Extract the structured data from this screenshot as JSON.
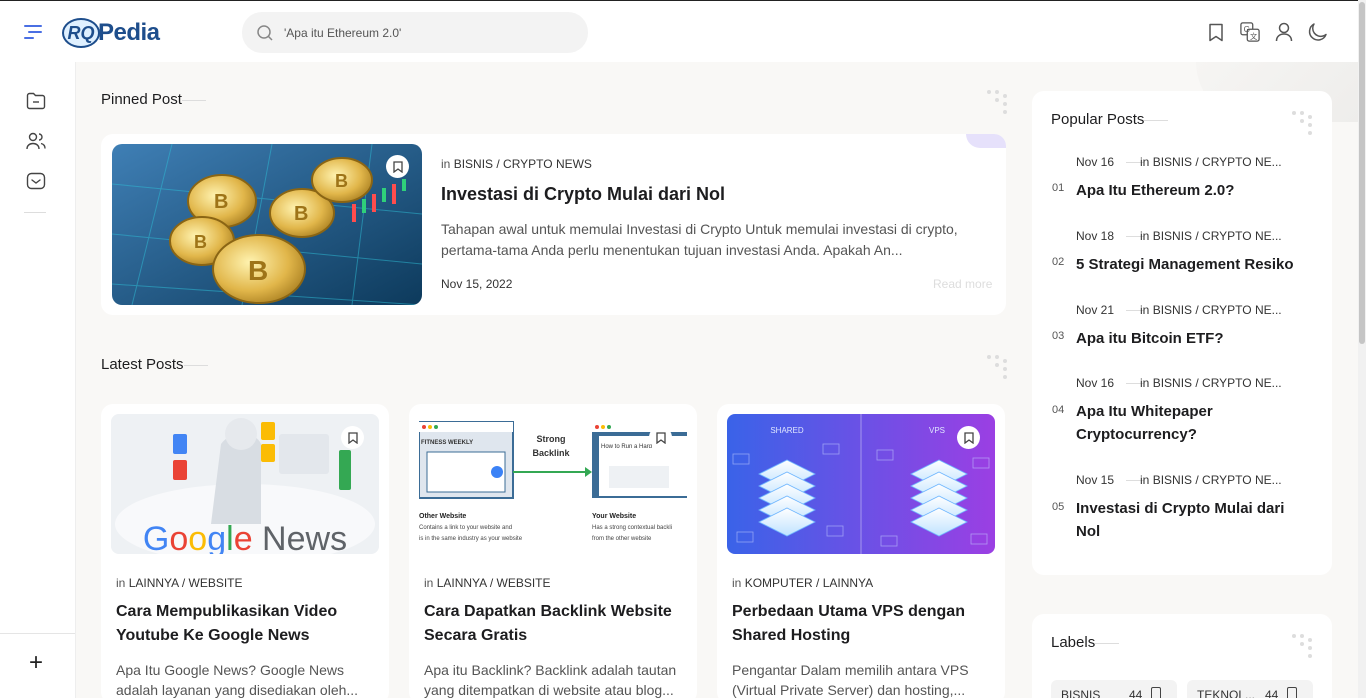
{
  "header": {
    "logo_rq": "RQ",
    "logo_pedia": "Pedia",
    "search_placeholder": "'Apa itu Ethereum 2.0'"
  },
  "pinned": {
    "section_title": "Pinned Post",
    "in_label": "in",
    "category": "BISNIS / CRYPTO NEWS",
    "title": "Investasi di Crypto Mulai dari Nol",
    "excerpt": "Tahapan awal untuk memulai Investasi di Crypto Untuk memulai investasi di crypto, pertama-tama Anda perlu menentukan tujuan investasi Anda. Apakah An...",
    "date": "Nov 15, 2022",
    "read_more": "Read more"
  },
  "latest": {
    "section_title": "Latest Posts",
    "posts": [
      {
        "in_label": "in",
        "category": "LAINNYA / WEBSITE",
        "title": "Cara Mempublikasikan Video Youtube Ke Google News",
        "excerpt": "Apa Itu Google News? Google News adalah layanan yang disediakan oleh...",
        "image_text": "Google News"
      },
      {
        "in_label": "in",
        "category": "LAINNYA / WEBSITE",
        "title": "Cara Dapatkan Backlink Website Secara Gratis",
        "excerpt": "Apa itu Backlink? Backlink adalah tautan yang ditempatkan di website atau blog...",
        "image_labels": {
          "fitness": "FITNESS WEEKLY",
          "strong": "Strong",
          "backlink": "Backlink",
          "howto": "How to Run a Hard",
          "other": "Other Website",
          "other_sub1": "Contains a link to your website and",
          "other_sub2": "is in the same industry as your website",
          "your": "Your Website",
          "your_sub1": "Has a strong contextual backli",
          "your_sub2": "from the other website"
        }
      },
      {
        "in_label": "in",
        "category": "KOMPUTER / LAINNYA",
        "title": "Perbedaan Utama VPS dengan Shared Hosting",
        "excerpt": "Pengantar Dalam memilih antara VPS (Virtual Private Server) dan hosting,...",
        "image_labels": {
          "shared": "SHARED",
          "vps": "VPS"
        }
      }
    ]
  },
  "popular": {
    "section_title": "Popular Posts",
    "items": [
      {
        "num": "01",
        "date": "Nov 16",
        "in_label": "in",
        "category": "BISNIS / CRYPTO NE...",
        "title": "Apa Itu Ethereum 2.0?"
      },
      {
        "num": "02",
        "date": "Nov 18",
        "in_label": "in",
        "category": "BISNIS / CRYPTO NE...",
        "title": "5 Strategi Management Resiko"
      },
      {
        "num": "03",
        "date": "Nov 21",
        "in_label": "in",
        "category": "BISNIS / CRYPTO NE...",
        "title": "Apa itu Bitcoin ETF?"
      },
      {
        "num": "04",
        "date": "Nov 16",
        "in_label": "in",
        "category": "BISNIS / CRYPTO NE...",
        "title": "Apa Itu Whitepaper Cryptocurrency?"
      },
      {
        "num": "05",
        "date": "Nov 15",
        "in_label": "in",
        "category": "BISNIS / CRYPTO NE...",
        "title": "Investasi di Crypto Mulai dari Nol"
      }
    ]
  },
  "labels": {
    "section_title": "Labels",
    "items": [
      {
        "name": "BISNIS",
        "count": "44"
      },
      {
        "name": "TEKNOL...",
        "count": "44"
      }
    ]
  },
  "icons": {
    "menu": "menu-icon",
    "search": "search-icon",
    "bookmark": "bookmark-icon",
    "translate": "translate-icon",
    "user": "user-icon",
    "dark_mode": "moon-icon",
    "sidebar": [
      "folder-icon",
      "users-icon",
      "inbox-icon"
    ],
    "add": "plus-icon"
  },
  "colors": {
    "brand": "#1e4e8c",
    "accent": "#4a6fe3",
    "tab": "#e6e1fb"
  }
}
